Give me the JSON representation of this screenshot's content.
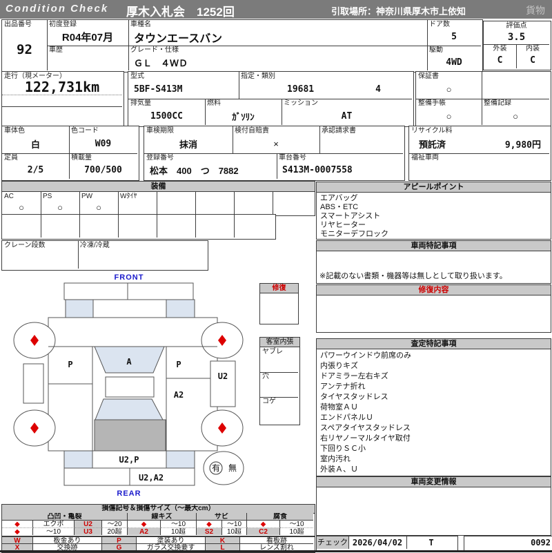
{
  "top_bar": {
    "brand": "Condition  Check",
    "auction": "厚木入札会　1252回",
    "pickup": "引取場所：神奈川県厚木市上依知",
    "category": "貨物"
  },
  "header": {
    "lot_label": "出品番号",
    "lot_value": "92",
    "first_reg_label": "初度登録",
    "first_reg_value": "R04年07月",
    "history_label": "車歴",
    "model_name_label": "車種名",
    "model_name_value": "タウンエースバン",
    "grade_label": "グレード・仕様",
    "grade_value": "ＧＬ　４ＷＤ",
    "doors_label": "ドア数",
    "doors_value": "5",
    "drive_label": "駆動",
    "drive_value": "4WD",
    "score_label": "評価点",
    "score_value": "3.5",
    "exterior_label": "外装",
    "exterior_value": "C",
    "interior_label": "内装",
    "interior_value": "C"
  },
  "specs": {
    "mileage_label": "走行（現メーター）",
    "mileage_value": "122,731km",
    "model_code_label": "型式",
    "model_code_value": "5BF-S413M",
    "class_label": "指定・類別",
    "class_value1": "19681",
    "class_value2": "4",
    "displacement_label": "排気量",
    "displacement_value": "1500CC",
    "fuel_label": "燃料",
    "fuel_value": "ｶﾞｿﾘﾝ",
    "transmission_label": "ミッション",
    "transmission_value": "AT",
    "warranty_label": "保証書",
    "warranty_mark": "○",
    "maintenance_book_label": "整備手帳",
    "maintenance_book_mark": "○",
    "maintenance_record_label": "整備記録",
    "maintenance_record_mark": "○"
  },
  "registration": {
    "body_color_label": "車体色",
    "body_color_value": "白",
    "color_code_label": "色コード",
    "color_code_value": "W09",
    "capacity_label": "定員",
    "capacity_value": "2/5",
    "load_label": "積載量",
    "load_value": "700/500",
    "inspection_label": "車検期限",
    "inspection_value": "抹消",
    "insurance_label": "検付自賠責",
    "insurance_mark": "×",
    "approval_label": "承認請求書",
    "plate_label": "登録番号",
    "plate_value": "松本　400　つ　7882",
    "chassis_label": "車台番号",
    "chassis_value": "S413M-0007558",
    "recycle_label": "リサイクル料",
    "recycle_status": "預託済",
    "recycle_fee": "9,980円",
    "welfare_label": "福祉車両"
  },
  "equipment": {
    "title": "装備",
    "row1": [
      {
        "label": "AC",
        "mark": "○"
      },
      {
        "label": "PS",
        "mark": "○"
      },
      {
        "label": "PW",
        "mark": "○"
      },
      {
        "label": "Wﾀｲﾔ",
        "mark": ""
      },
      {
        "label": "",
        "mark": ""
      },
      {
        "label": "",
        "mark": ""
      },
      {
        "label": "",
        "mark": ""
      },
      {
        "label": "",
        "mark": ""
      }
    ],
    "crane_label": "クレーン段数",
    "refrigeration_label": "冷凍/冷蔵"
  },
  "appeal": {
    "title": "アピールポイント",
    "items": [
      "エアバッグ",
      "ABS・ETC",
      "スマートアシスト",
      "リヤヒーター",
      "モニターデフロック"
    ]
  },
  "vehicle_notes": {
    "title": "車両特記事項",
    "note": "※記載のない書類・機器等は無しとして取り扱います。"
  },
  "repair": {
    "title": "修復内容"
  },
  "assessment": {
    "title": "査定特記事項",
    "items": [
      "パワーウインドウ前席のみ",
      "内張りキズ",
      "ドアミラー左右キズ",
      "アンテナ折れ",
      "タイヤスタッドレス",
      "荷物室ＡＵ",
      "エンドパネルＵ",
      "スペアタイヤスタッドレス",
      "右リヤノーマルタイヤ取付",
      "下回りＳＣ小",
      "室内汚れ",
      "外装Ａ、Ｕ"
    ]
  },
  "change_info": {
    "title": "車両変更情報"
  },
  "check": {
    "label": "チェック",
    "date": "2026/04/02",
    "inspector": "T",
    "number": "0092"
  },
  "diagram": {
    "front_label": "FRONT",
    "rear_label": "REAR",
    "marks": {
      "left_front_door": "P",
      "windshield": "A",
      "right_front_door": "P",
      "right_side": "U2",
      "right_rear": "A2",
      "tailgate": "U2,P",
      "rear_bumper": "U2,A2"
    },
    "presence": {
      "yes": "有",
      "no": "無"
    },
    "repair_box_title": "修復",
    "interior_box": {
      "title": "客室内張",
      "rows": [
        "ヤブレ",
        "穴",
        "コゲ"
      ]
    }
  },
  "legend": {
    "title": "損傷記号＆損傷サイズ（〜最大cm）",
    "groups": [
      {
        "name": "凸凹・亀裂",
        "rows": [
          [
            "◆",
            "エクボ",
            "U2",
            "〜20"
          ],
          [
            "◆",
            "〜10",
            "U3",
            "20超"
          ]
        ]
      },
      {
        "name": "線キズ",
        "rows": [
          [
            "◆",
            "〜10"
          ],
          [
            "A2",
            "10超"
          ]
        ]
      },
      {
        "name": "サビ",
        "rows": [
          [
            "◆",
            "〜10"
          ],
          [
            "S2",
            "10超"
          ]
        ]
      },
      {
        "name": "腐食",
        "rows": [
          [
            "◆",
            "〜10"
          ],
          [
            "C2",
            "10超"
          ]
        ]
      }
    ],
    "symbols": [
      {
        "code": "W",
        "label": "板金あり"
      },
      {
        "code": "X",
        "label": "交換跡"
      },
      {
        "code": "P",
        "label": "塗装あり"
      },
      {
        "code": "G",
        "label": "ガラス交換要す"
      },
      {
        "code": "K",
        "label": "看板跡"
      },
      {
        "code": "L",
        "label": "レンズ割れ"
      }
    ],
    "colors": {
      "diamond": "#dd0000",
      "header_bg": "#c9c9c9"
    }
  }
}
